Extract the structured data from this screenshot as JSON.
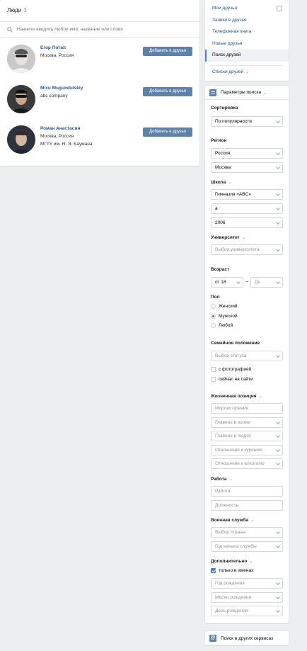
{
  "header": {
    "title": "Люди",
    "count": "3"
  },
  "search": {
    "placeholder": "Начните вводить любое имя, название или слово"
  },
  "people": [
    {
      "name": "Егор Потап",
      "info1": "Москва, Россия",
      "info2": "",
      "button": "Добавить в друзья"
    },
    {
      "name": "Mixu Mugundulskiy",
      "info1": "abc company",
      "info2": "",
      "button": "Добавить в друзья"
    },
    {
      "name": "Роман Анастасин",
      "info1": "Москва, Россия",
      "info2": "МГТУ им. Н. Э. Баумана",
      "button": "Добавить в друзья"
    }
  ],
  "nav": {
    "items": [
      "Мои друзья",
      "Заявки в друзья",
      "Телефонная книга",
      "Новые друзья",
      "Поиск друзей"
    ],
    "active_index": 4,
    "lists_label": "Списки друзей"
  },
  "filters": {
    "title": "Параметры поиска",
    "sort_label": "Сортировка",
    "sort_value": "По популярности",
    "region_label": "Регион",
    "country": "Россия",
    "city": "Москва",
    "school_label": "Школа",
    "school": "Гимназия «ABC»",
    "school_class": "а",
    "school_year": "2006",
    "university_label": "Университет",
    "university_placeholder": "Выбор университета",
    "age_label": "Возраст",
    "age_from": "от 18",
    "age_dash": "–",
    "age_to": "До",
    "gender_label": "Пол",
    "gender_options": [
      "Женский",
      "Мужской",
      "Любой"
    ],
    "gender_selected": 1,
    "marital_label": "Семейное положение",
    "marital_placeholder": "Выбор статуса",
    "with_photo": "с фотографией",
    "online_now": "сейчас на сайте",
    "life_label": "Жизненная позиция",
    "life_fields": [
      "Мировоззрение",
      "Главное в жизни",
      "Главное в людях",
      "Отношение к курению",
      "Отношение к алкоголю"
    ],
    "work_label": "Работа",
    "work_fields": [
      "Работа",
      "Должность"
    ],
    "military_label": "Военная служба",
    "military_fields": [
      "Выбор страны",
      "Год начала службы"
    ],
    "extra_label": "Дополнительно",
    "names_only": "только в именах",
    "extra_fields": [
      "Год рождения",
      "Месяц рождения",
      "День рождения"
    ]
  },
  "other_services": "Поиск в других сервисах",
  "colors": {
    "link": "#2a5885",
    "button": "#5e81a8",
    "accent": "#5181b8",
    "background": "#edeef0"
  }
}
